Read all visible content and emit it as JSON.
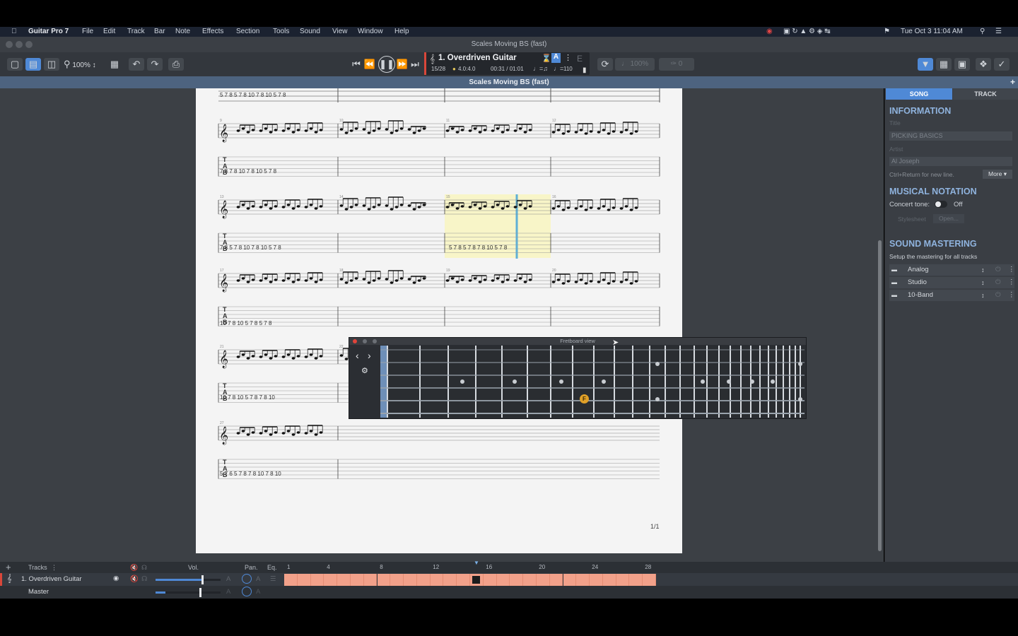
{
  "menubar": {
    "app_name": "Guitar Pro 7",
    "items": [
      "File",
      "Edit",
      "Track",
      "Bar",
      "Note",
      "Effects",
      "Section",
      "Tools",
      "Sound",
      "View",
      "Window",
      "Help"
    ],
    "clock": "Tue Oct 3  11:04 AM"
  },
  "window": {
    "title": "Scales Moving BS (fast)"
  },
  "toolbar": {
    "zoom": "100%",
    "track_name": "1. Overdriven Guitar",
    "bar_position": "15/28",
    "time_signature": "4.0:4.0",
    "time_position": "00:31 / 01:01",
    "tempo": "110",
    "tuning_note": "E",
    "speed": "100%",
    "count": "0"
  },
  "doc_title": "Scales Moving BS (fast)",
  "score": {
    "page_number": "1/1",
    "bar_numbers": [
      "9",
      "10",
      "11",
      "12",
      "13",
      "14",
      "15",
      "16",
      "17",
      "18",
      "19",
      "20",
      "21",
      "22",
      "25",
      "26",
      "27",
      "28"
    ],
    "tab_letters": [
      "T",
      "A",
      "B"
    ],
    "row_first_tab": [
      "5 7 8  5 7 8 10  7 8 10  5 7 8",
      "7 8  7 8 10  7 8 10  5 7 8",
      "7 8  5 7 8 10  7 8 10  5 7 8",
      "10  7 8 10  5 7 8  5 7 8",
      "10  7 8 10  5 7 8  7 8 10",
      "5 7 6  5 7 8  7 8 10  7 8 10"
    ],
    "highlight_tab": "5 7 8  5 7 8  7 8 10  5 7 8"
  },
  "panel": {
    "tabs": [
      "SONG",
      "TRACK"
    ],
    "information": "INFORMATION",
    "title_label": "Title",
    "title_value": "PICKING BASICS",
    "artist_label": "Artist",
    "artist_value": "Al Joseph",
    "newline_hint": "Ctrl+Return for new line.",
    "more_button": "More",
    "musical_notation": "MUSICAL NOTATION",
    "concert_tone": "Concert tone:",
    "concert_tone_state": "Off",
    "stylesheet_label": "Stylesheet",
    "open_button": "Open...",
    "sound_mastering": "SOUND MASTERING",
    "mastering_hint": "Setup the mastering for all tracks",
    "effects": [
      "Analog",
      "Studio",
      "10-Band"
    ]
  },
  "fretboard": {
    "title": "Fretboard view",
    "marker_note": "F"
  },
  "tracks": {
    "header_label": "Tracks",
    "vol_label": "Vol.",
    "pan_label": "Pan.",
    "eq_label": "Eq.",
    "timeline": [
      "1",
      "4",
      "8",
      "12",
      "16",
      "20",
      "24",
      "28"
    ],
    "track1": "1. Overdriven Guitar",
    "master": "Master",
    "auto_label": "A",
    "bar_count": 28,
    "current_bar": 15
  },
  "colors": {
    "accent": "#4f89d6",
    "panel_heading": "#8fb3de",
    "track_bars": "#f2a18a",
    "highlight": "#f8f5c8",
    "cursor": "#5fb0d6",
    "fret_marker": "#e0a028"
  }
}
